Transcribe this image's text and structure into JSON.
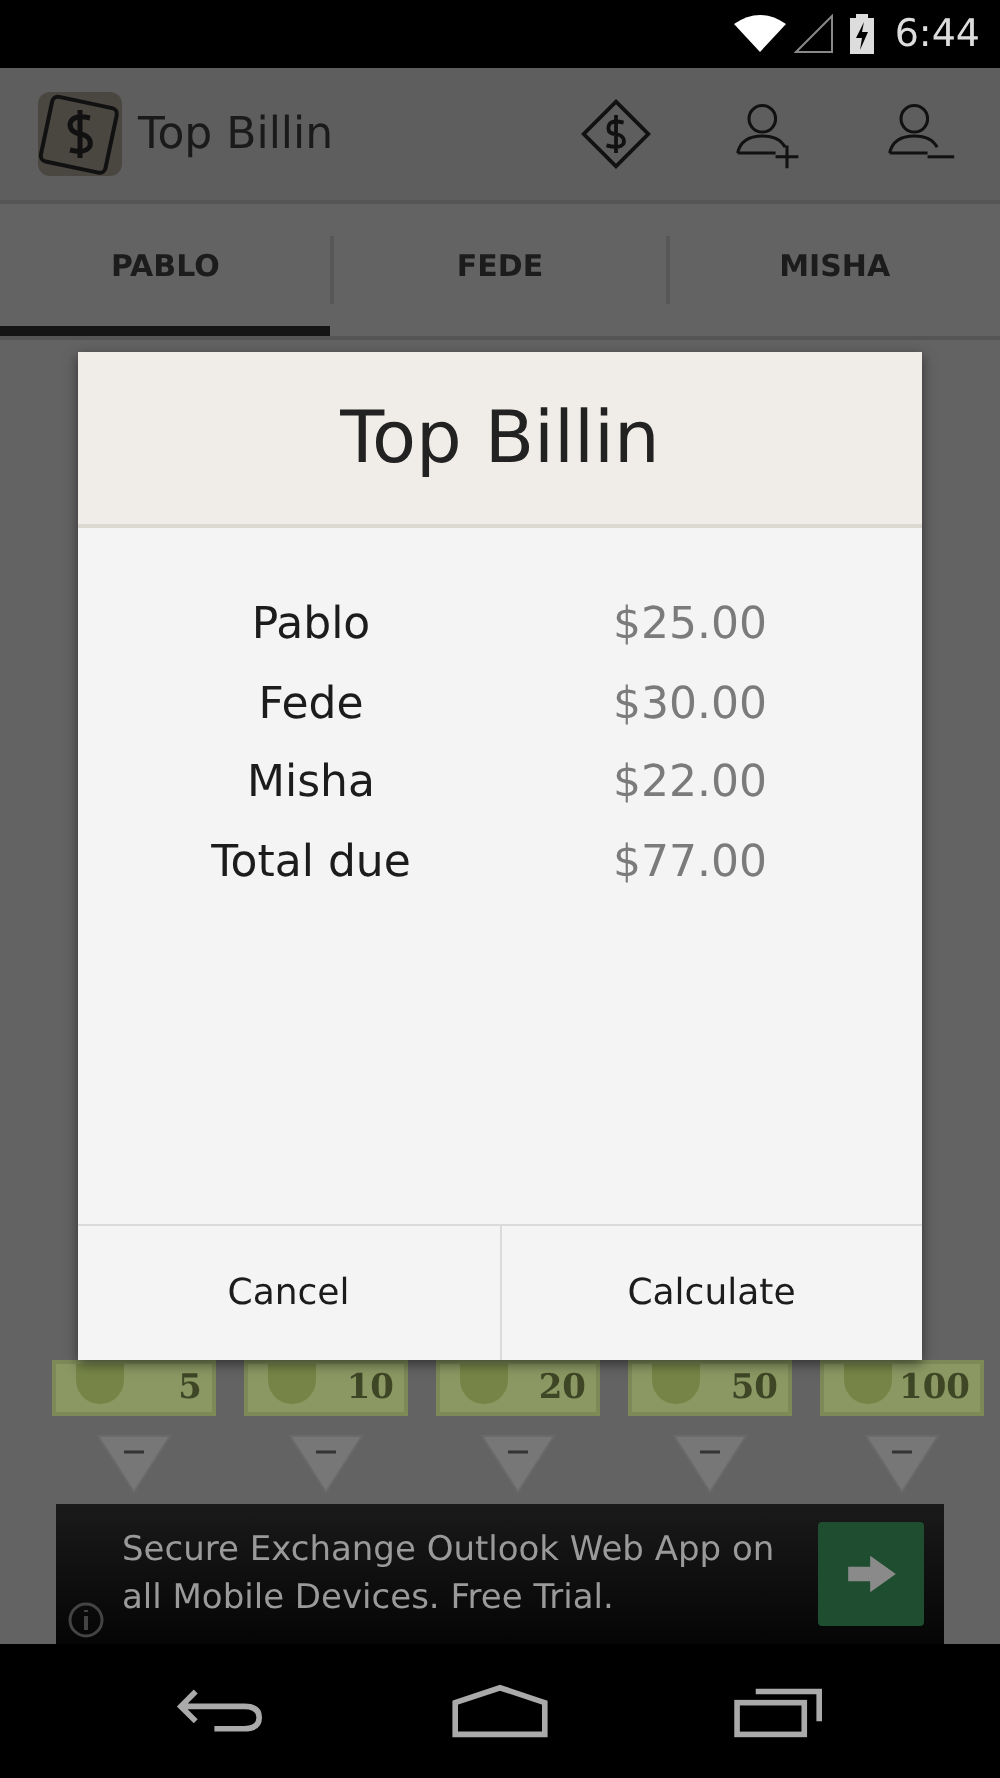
{
  "status_bar": {
    "time": "6:44"
  },
  "app_bar": {
    "title": "Top Billin"
  },
  "tabs": [
    {
      "label": "PABLO",
      "selected": true
    },
    {
      "label": "FEDE",
      "selected": false
    },
    {
      "label": "MISHA",
      "selected": false
    }
  ],
  "bills": [
    {
      "denomination": "5"
    },
    {
      "denomination": "10"
    },
    {
      "denomination": "20"
    },
    {
      "denomination": "50"
    },
    {
      "denomination": "100"
    }
  ],
  "dialog": {
    "title": "Top Billin",
    "rows": [
      {
        "name": "Pablo",
        "amount": "$25.00"
      },
      {
        "name": "Fede",
        "amount": "$30.00"
      },
      {
        "name": "Misha",
        "amount": "$22.00"
      },
      {
        "name": "Total due",
        "amount": "$77.00"
      }
    ],
    "buttons": [
      "Cancel",
      "Calculate"
    ]
  },
  "ad": {
    "text": "Secure Exchange Outlook Web App on all Mobile Devices. Free Trial."
  }
}
